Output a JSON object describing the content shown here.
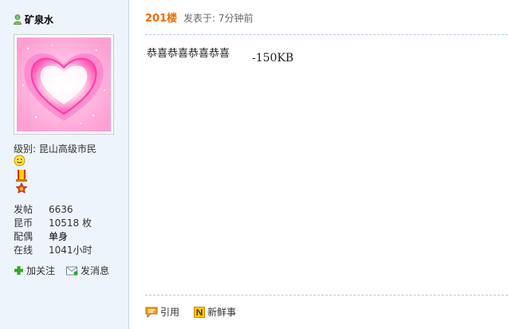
{
  "user": {
    "name": "矿泉水",
    "level_text": "级别: 昆山高级市民",
    "stats": [
      {
        "key": "发帖",
        "value": "6636",
        "bold": false
      },
      {
        "key": "昆币",
        "value": "10518 枚",
        "bold": false
      },
      {
        "key": "配偶",
        "value": "单身",
        "bold": true
      },
      {
        "key": "在线",
        "value": "1041小时",
        "bold": false
      }
    ],
    "actions": {
      "follow": "加关注",
      "message": "发消息"
    }
  },
  "post": {
    "floor": "201楼",
    "posted_text": "发表于: 7分钟前",
    "content_line1": "恭喜恭喜恭喜恭喜",
    "content_line2": "-150KB"
  },
  "footer": {
    "quote": "引用",
    "new_story": "新鲜事"
  },
  "colors": {
    "panel_bg": "#eef4fb",
    "floor_orange": "#f26c00",
    "divider": "#b8c9dc"
  },
  "icons": {
    "user": "user-icon",
    "avatar": "heart-avatar",
    "smile": "smile-icon",
    "medal": "medal-icon",
    "follow": "plus-icon",
    "message": "envelope-icon",
    "quote": "quote-bubble-icon",
    "new_story": "n-badge-icon"
  }
}
